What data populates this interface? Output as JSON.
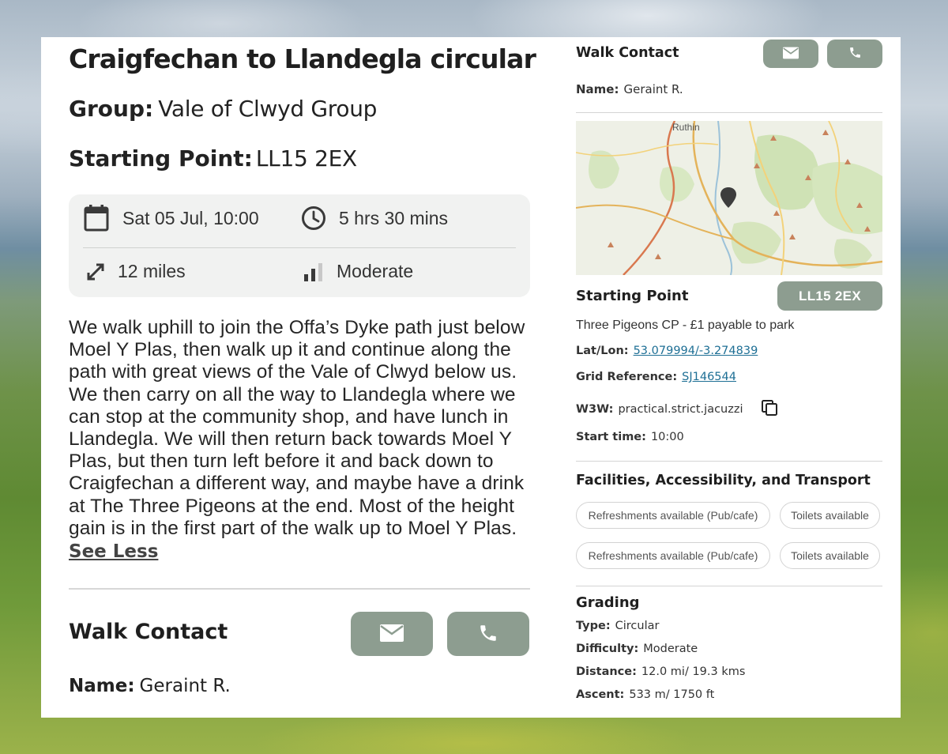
{
  "walk": {
    "title": "Craigfechan to Llandegla circular",
    "group_label": "Group:",
    "group_value": "Vale of Clwyd Group",
    "starting_point_label": "Starting Point:",
    "starting_point_value": "LL15 2EX",
    "stats": {
      "date": "Sat 05 Jul, 10:00",
      "duration": "5 hrs 30 mins",
      "distance": "12 miles",
      "difficulty": "Moderate"
    },
    "description": "We walk uphill to join the Offa’s Dyke path just below Moel Y Plas, then walk up it and continue along the path with great views of the Vale of Clwyd below us. We then carry on all the way to Llandegla where we can stop at the community shop, and have lunch  in Llandegla. We will then return back towards Moel Y Plas, but then turn left before it and back down to Craigfechan a different way, and maybe have a drink at The Three Pigeons at the end. Most of the height gain is in the first part of the walk up to Moel Y Plas.",
    "see_less": "See Less"
  },
  "contact": {
    "title": "Walk Contact",
    "name_label": "Name:",
    "name_value": "Geraint R."
  },
  "map": {
    "town_label": "Ruthin"
  },
  "starting_point": {
    "title": "Starting Point",
    "postcode": "LL15 2EX",
    "location": "Three Pigeons CP - £1 payable to park",
    "latlon_label": "Lat/Lon:",
    "latlon_value": "53.079994/-3.274839",
    "grid_label": "Grid Reference:",
    "grid_value": "SJ146544",
    "w3w_label": "W3W:",
    "w3w_value": "practical.strict.jacuzzi",
    "start_label": "Start time:",
    "start_value": "10:00"
  },
  "facilities": {
    "title": "Facilities, Accessibility, and Transport",
    "chips": [
      "Refreshments available (Pub/cafe)",
      "Toilets available",
      "Refreshments available (Pub/cafe)",
      "Toilets available"
    ]
  },
  "grading": {
    "title": "Grading",
    "type_label": "Type:",
    "type_value": "Circular",
    "difficulty_label": "Difficulty:",
    "difficulty_value": "Moderate",
    "distance_label": "Distance:",
    "distance_value": "12.0 mi/ 19.3 kms",
    "ascent_label": "Ascent:",
    "ascent_value": "533 m/ 1750 ft"
  },
  "icons": {
    "calendar": "calendar-icon",
    "clock": "clock-icon",
    "distance": "expand-arrows-icon",
    "difficulty": "signal-bars-icon",
    "email": "envelope-icon",
    "phone": "phone-icon",
    "copy": "copy-icon",
    "map_pin": "map-pin-icon"
  },
  "colors": {
    "button_bg": "#8d9d90",
    "stats_bg": "#f1f2f1",
    "link": "#1e6f95"
  }
}
